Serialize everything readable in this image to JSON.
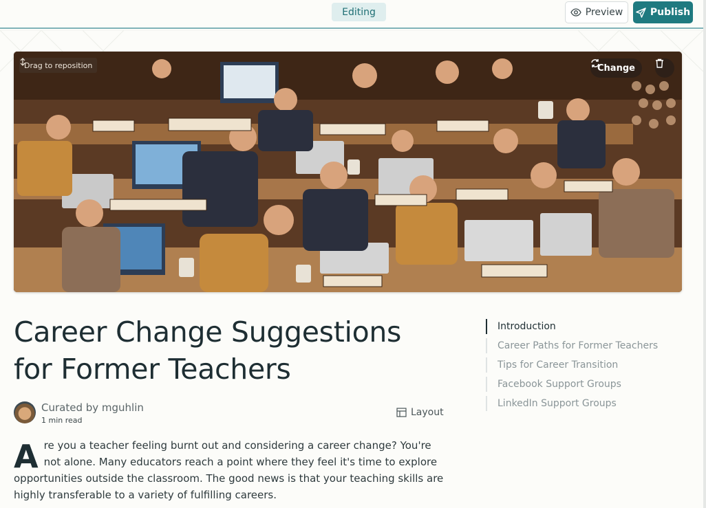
{
  "toolbar": {
    "status": "Editing",
    "preview_label": "Preview",
    "publish_label": "Publish"
  },
  "hero": {
    "drag_hint": "Drag to reposition",
    "change_label": "Change",
    "icons": [
      "move-vertical-icon",
      "refresh-icon",
      "trash-icon"
    ]
  },
  "article": {
    "title_line1": "Career Change Suggestions",
    "title_line2": "for Former Teachers",
    "author": "Curated by mguhlin",
    "read_time": "1 min read",
    "layout_label": "Layout",
    "dropcap": "A",
    "intro": "re you a teacher feeling burnt out and considering a career change? You're not alone. Many educators reach a point where they feel it's time to explore opportunities outside the classroom. The good news is that your teaching skills are highly transferable to a variety of fulfilling careers."
  },
  "toc": {
    "items": [
      {
        "label": "Introduction",
        "active": true
      },
      {
        "label": "Career Paths for Former Teachers",
        "active": false
      },
      {
        "label": "Tips for Career Transition",
        "active": false
      },
      {
        "label": "Facebook Support Groups",
        "active": false
      },
      {
        "label": "LinkedIn Support Groups",
        "active": false
      }
    ]
  },
  "colors": {
    "accent": "#1f7a80",
    "editing_bg": "#dfeeee",
    "background": "#fcfcf9",
    "heading": "#1e2e33"
  }
}
